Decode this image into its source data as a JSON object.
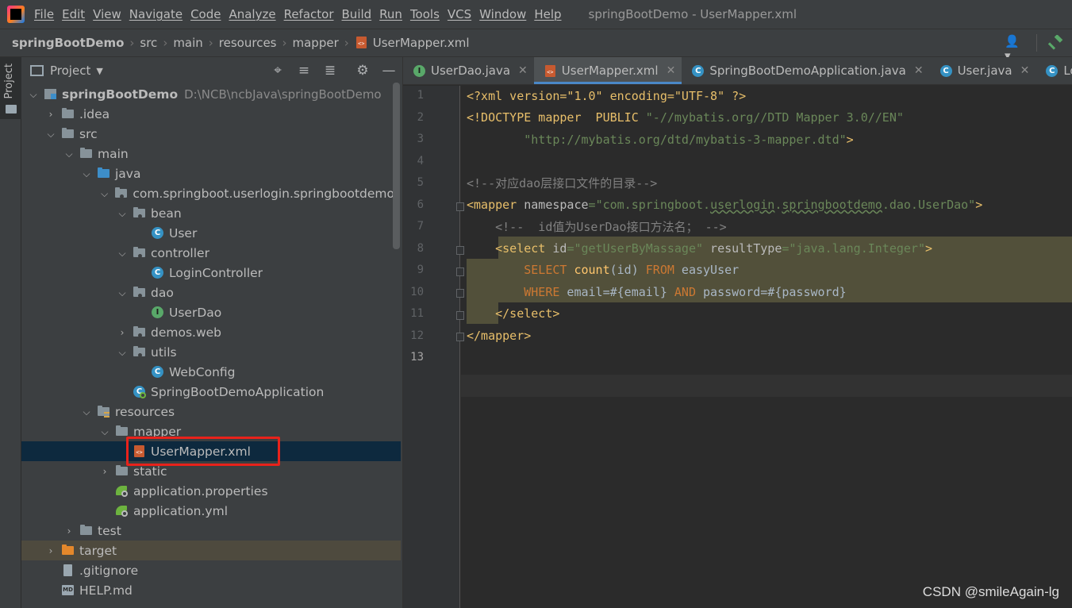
{
  "menubar": {
    "items": [
      "File",
      "Edit",
      "View",
      "Navigate",
      "Code",
      "Analyze",
      "Refactor",
      "Build",
      "Run",
      "Tools",
      "VCS",
      "Window",
      "Help"
    ],
    "window_title": "springBootDemo - UserMapper.xml"
  },
  "breadcrumbs": [
    "springBootDemo",
    "src",
    "main",
    "resources",
    "mapper",
    "UserMapper.xml"
  ],
  "toolstrip": {
    "project_tab": "Project"
  },
  "project_panel": {
    "title": "Project",
    "tree": [
      {
        "label": "springBootDemo",
        "path": "D:\\NCB\\ncbJava\\springBootDemo"
      },
      {
        "label": ".idea"
      },
      {
        "label": "src"
      },
      {
        "label": "main"
      },
      {
        "label": "java"
      },
      {
        "label": "com.springboot.userlogin.springbootdemo"
      },
      {
        "label": "bean"
      },
      {
        "label": "User"
      },
      {
        "label": "controller"
      },
      {
        "label": "LoginController"
      },
      {
        "label": "dao"
      },
      {
        "label": "UserDao"
      },
      {
        "label": "demos.web"
      },
      {
        "label": "utils"
      },
      {
        "label": "WebConfig"
      },
      {
        "label": "SpringBootDemoApplication"
      },
      {
        "label": "resources"
      },
      {
        "label": "mapper"
      },
      {
        "label": "UserMapper.xml"
      },
      {
        "label": "static"
      },
      {
        "label": "application.properties"
      },
      {
        "label": "application.yml"
      },
      {
        "label": "test"
      },
      {
        "label": "target"
      },
      {
        "label": ".gitignore"
      },
      {
        "label": "HELP.md"
      }
    ]
  },
  "editor": {
    "tabs": [
      "UserDao.java",
      "UserMapper.xml",
      "SpringBootDemoApplication.java",
      "User.java",
      "Logi"
    ],
    "active_tab": "UserMapper.xml",
    "line_numbers": [
      "1",
      "2",
      "3",
      "4",
      "5",
      "6",
      "7",
      "8",
      "9",
      "10",
      "11",
      "12",
      "13"
    ],
    "current_line": "13",
    "code": {
      "l1_a": "<?xml version=\"1.0\" encoding=\"UTF-8\" ?>",
      "l2_a": "<!DOCTYPE mapper  PUBLIC ",
      "l2_b": "\"-//mybatis.org//DTD Mapper 3.0//EN\"",
      "l3_a": "        ",
      "l3_b": "\"http://mybatis.org/dtd/mybatis-3-mapper.dtd\"",
      "l3_c": ">",
      "l5": "<!--对应dao层接口文件的目录-->",
      "l6_a": "<mapper ",
      "l6_b": "namespace",
      "l6_c": "=",
      "l6_d": "\"com.springboot.",
      "l6_e": "userlogin",
      "l6_f": ".",
      "l6_g": "springbootdemo",
      "l6_h": ".dao.UserDao\"",
      "l6_i": ">",
      "l7": "    <!--  id值为UserDao接口方法名； -->",
      "l8_a": "    <select ",
      "l8_b": "id",
      "l8_c": "=",
      "l8_d": "\"getUserByMassage\"",
      "l8_e": " resultType",
      "l8_f": "=",
      "l8_g": "\"java.lang.Integer\"",
      "l8_h": ">",
      "l9_a": "        SELECT ",
      "l9_b": "count",
      "l9_c": "(id) ",
      "l9_d": "FROM",
      "l9_e": " easyUser",
      "l10_a": "        WHERE",
      "l10_b": " email=#{email} ",
      "l10_c": "AND",
      "l10_d": " password=#{password}",
      "l11": "    </select>",
      "l12": "</mapper>"
    }
  },
  "watermark": "CSDN @smileAgain-lg",
  "colors": {
    "selection": "#0d293e",
    "highlight_box": "#e8221b",
    "tab_underline": "#4a88c7"
  }
}
